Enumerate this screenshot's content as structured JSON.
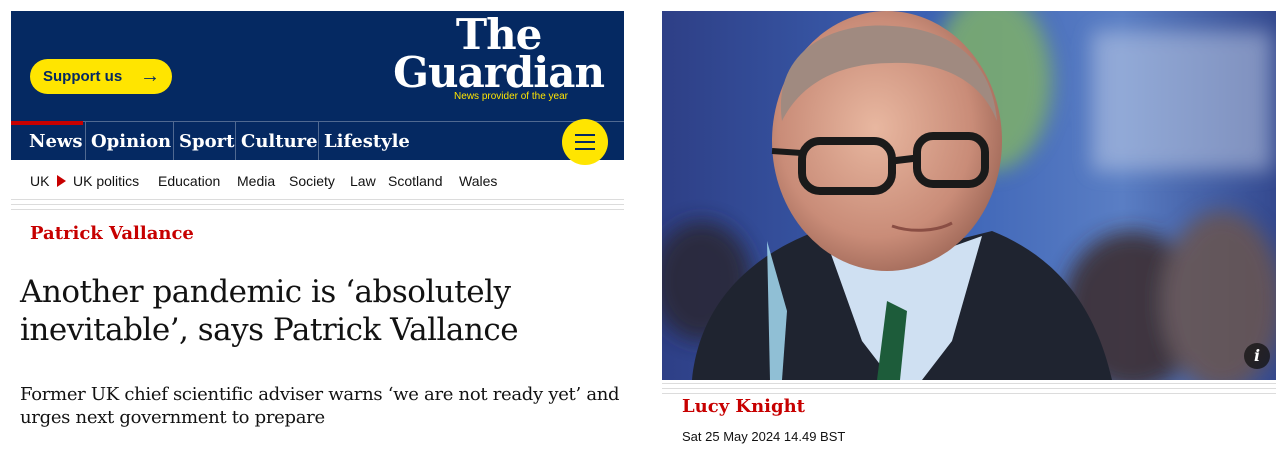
{
  "masthead": {
    "support_label": "Support us",
    "support_arrow": "→",
    "logo_the": "The",
    "logo_guardian": "Guardian",
    "logo_tagline": "News provider of the year",
    "colors": {
      "background": "#052962",
      "accent": "#ffe500"
    }
  },
  "nav": {
    "pillars": [
      {
        "label": "News",
        "active": true
      },
      {
        "label": "Opinion"
      },
      {
        "label": "Sport"
      },
      {
        "label": "Culture"
      },
      {
        "label": "Lifestyle"
      }
    ],
    "menu_icon": "hamburger-menu-icon"
  },
  "subnav": {
    "items": [
      "UK",
      "UK politics",
      "Education",
      "Media",
      "Society",
      "Law",
      "Scotland",
      "Wales"
    ],
    "current_marker_icon": "triangle-right-icon"
  },
  "article": {
    "kicker": "Patrick Vallance",
    "headline_line1": "Another pandemic is ‘absolutely",
    "headline_line2": "inevitable’, says Patrick Vallance",
    "standfirst_line1": "Former UK chief scientific adviser warns ‘we are not ready yet’ and",
    "standfirst_line2": "urges next government to prepare",
    "byline": "Lucy Knight",
    "date": "Sat 25 May 2024 14.49 BST",
    "photo_info_label": "i",
    "kicker_color": "#c70000"
  }
}
